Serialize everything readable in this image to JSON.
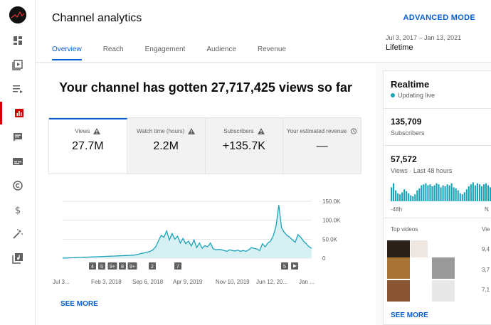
{
  "header": {
    "title": "Channel analytics",
    "advanced_mode": "ADVANCED MODE",
    "date_range": "Jul 3, 2017 – Jan 13, 2021",
    "date_label": "Lifetime",
    "tabs": [
      "Overview",
      "Reach",
      "Engagement",
      "Audience",
      "Revenue"
    ]
  },
  "sidebar": {
    "items": [
      "dashboard-icon",
      "content-icon",
      "playlists-icon",
      "analytics-icon",
      "comments-icon",
      "subtitles-icon",
      "copyright-icon",
      "monetization-icon",
      "customization-icon",
      "audio-library-icon"
    ]
  },
  "main": {
    "headline": "Your channel has gotten 27,717,425 views so far",
    "metrics": [
      {
        "label": "Views",
        "value": "27.7M"
      },
      {
        "label": "Watch time (hours)",
        "value": "2.2M"
      },
      {
        "label": "Subscribers",
        "value": "+135.7K"
      },
      {
        "label": "Your estimated revenue",
        "value": "—"
      }
    ],
    "see_more": "SEE MORE"
  },
  "chart_data": {
    "type": "area",
    "title": "",
    "x_ticks": [
      "Jul 3...",
      "Feb 3, 2018",
      "Sep 6, 2018",
      "Apr 9, 2019",
      "Nov 10, 2019",
      "Jun 12, 20...",
      "Jan ..."
    ],
    "y_ticks": [
      "150.0K",
      "100.0K",
      "50.0K",
      "0"
    ],
    "ylim": [
      0,
      150000
    ],
    "markers": [
      "4",
      "5",
      "9+",
      "8",
      "9+",
      "2",
      "7",
      "5"
    ],
    "series": [
      {
        "values": [
          0,
          300,
          600,
          900,
          1200,
          1500,
          1800,
          2100,
          2400,
          2700,
          3000,
          3300,
          3600,
          3900,
          4200,
          4500,
          4800,
          5100,
          5400,
          5700,
          6000,
          6300,
          6600,
          6900,
          7200,
          7500,
          8000,
          9000,
          11000,
          13000,
          14000,
          16000,
          18000,
          22000,
          30000,
          45000,
          60000,
          55000,
          72000,
          48000,
          65000,
          50000,
          58000,
          40000,
          52000,
          38000,
          45000,
          32000,
          48000,
          28000,
          40000,
          26000,
          33000,
          30000,
          40000,
          25000,
          22000,
          23000,
          22000,
          20000,
          18000,
          22000,
          20000,
          19000,
          21000,
          18000,
          20000,
          18000,
          22000,
          28000,
          26000,
          24000,
          20000,
          38000,
          30000,
          40000,
          45000,
          60000,
          85000,
          140000,
          80000,
          68000,
          60000,
          55000,
          48000,
          42000,
          62000,
          55000,
          45000,
          38000,
          30000,
          26000
        ]
      }
    ]
  },
  "realtime": {
    "title": "Realtime",
    "status": "Updating live",
    "subscribers_value": "135,709",
    "subscribers_label": "Subscribers",
    "views_value": "57,572",
    "views_label": "Views · Last 48 hours",
    "axis_left": "-48h",
    "axis_right": "N",
    "top_videos_label": "Top videos",
    "views_col": "Vie",
    "video_views": [
      "9,4",
      "3,7",
      "7,1"
    ],
    "bars": [
      70,
      90,
      55,
      40,
      35,
      45,
      60,
      50,
      40,
      30,
      25,
      35,
      55,
      65,
      80,
      85,
      90,
      80,
      85,
      75,
      80,
      90,
      85,
      70,
      80,
      75,
      85,
      80,
      90,
      70,
      65,
      55,
      40,
      35,
      45,
      60,
      75,
      85,
      95,
      80,
      90,
      85,
      75,
      85,
      90,
      80,
      70
    ],
    "see_more": "SEE MORE",
    "colors": {
      "bars": "#1aa3b8"
    }
  },
  "colors": {
    "accent": "#065fd4",
    "chart_line": "#1aa3b8",
    "chart_fill": "#d6f0f4",
    "active_nav": "#cc0000"
  }
}
